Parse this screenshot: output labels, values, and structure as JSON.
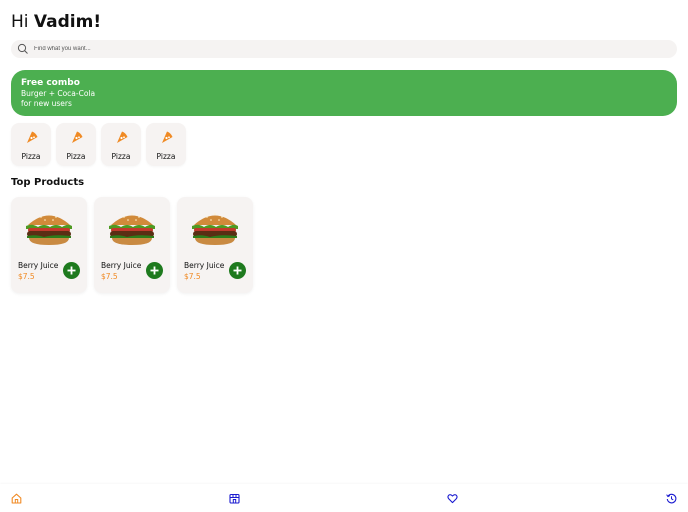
{
  "header": {
    "greeting": "Hi",
    "name": "Vadim!"
  },
  "search": {
    "placeholder": "Find what you want...",
    "icon": "search-icon"
  },
  "promo": {
    "title": "Free combo",
    "line1": "Burger + Coca-Cola",
    "line2": "for new users",
    "color": "#4caf50"
  },
  "categories": [
    {
      "label": "Pizza",
      "icon": "pizza-icon"
    },
    {
      "label": "Pizza",
      "icon": "pizza-icon"
    },
    {
      "label": "Pizza",
      "icon": "pizza-icon"
    },
    {
      "label": "Pizza",
      "icon": "pizza-icon"
    }
  ],
  "top_products": {
    "title": "Top Products",
    "items": [
      {
        "name": "Berry Juice",
        "price": "$7.5"
      },
      {
        "name": "Berry Juice",
        "price": "$7.5"
      },
      {
        "name": "Berry Juice",
        "price": "$7.5"
      }
    ]
  },
  "bottom_nav": [
    {
      "icon": "home-icon",
      "active": true
    },
    {
      "icon": "store-icon",
      "active": false
    },
    {
      "icon": "heart-icon",
      "active": false
    },
    {
      "icon": "history-icon",
      "active": false
    }
  ],
  "colors": {
    "accent": "#f08a24",
    "green": "#4caf50",
    "add_button": "#1e7a1e",
    "nav": "#1a1ad0"
  }
}
